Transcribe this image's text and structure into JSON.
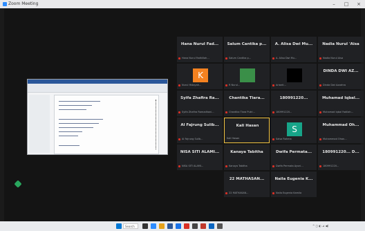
{
  "window": {
    "title": "Zoom Meeting",
    "accent": "#2d8cff"
  },
  "participants": [
    {
      "name": "Hana Nurul Fad...",
      "sub": "Hana Nurul Fadhillah...",
      "avatar": null
    },
    {
      "name": "Salum Cantika p...",
      "sub": "Salum Cantika p...",
      "avatar": null
    },
    {
      "name": "A. Alisa Dwi Mu...",
      "sub": "A. Alisa Dwi Mu...",
      "avatar": null
    },
    {
      "name": "Nadia Nurul 'Aisa",
      "sub": "Nadia Nurul Aisa",
      "avatar": null
    },
    {
      "name": "",
      "sub": "Nurul Hidayah...",
      "avatar": "K",
      "avatar_color": "#f58220"
    },
    {
      "name": "",
      "sub": "R Nurul...",
      "avatar": "",
      "avatar_color": "#3a8f48"
    },
    {
      "name": "",
      "sub": "Arianti...",
      "avatar": "",
      "avatar_color": "#000000"
    },
    {
      "name": "DINDA DWI AZ...",
      "sub": "Dinda Dwi Azzahra",
      "avatar": null
    },
    {
      "name": "Syifa Zhafira Ra...",
      "sub": "Syifa Zhafira Ramadhani...",
      "avatar": null
    },
    {
      "name": "Chantika Tiara...",
      "sub": "Chantika Tiara Putri...",
      "avatar": null
    },
    {
      "name": "180991220...",
      "sub": "180991220...",
      "avatar": null
    },
    {
      "name": "Muhamad Iqbal...",
      "sub": "Muhamad Iqbal Fadilah...",
      "avatar": null
    },
    {
      "name": "Al Fajrung Sulib...",
      "sub": "Al Fajrung Sulib...",
      "avatar": null
    },
    {
      "name": "Kali Hasan",
      "sub": "Kali Hasan",
      "avatar": null,
      "active": true
    },
    {
      "name": "",
      "sub": "Salsa Rahma",
      "avatar": "S",
      "avatar_color": "#17a589"
    },
    {
      "name": "Muhammad Oh...",
      "sub": "Muhammad Ohan...",
      "avatar": null
    },
    {
      "name": "NISA SITI ALAMI...",
      "sub": "NISA SITI ALAMI...",
      "avatar": null
    },
    {
      "name": "Kanaya Tabitha",
      "sub": "Kanaya Tabitha",
      "avatar": null
    },
    {
      "name": "Dwifa Permata...",
      "sub": "Dwifa Permata Ayuni...",
      "avatar": null
    },
    {
      "name": "180991220... D...",
      "sub": "180991220...",
      "avatar": null
    },
    {
      "name": "22 MATHASAN...",
      "sub": "22 MATHASAN...",
      "avatar": null
    },
    {
      "name": "Naila Eugenia K...",
      "sub": "Naila Eugenia Kamila",
      "avatar": null
    }
  ],
  "taskbar": {
    "search": "Search"
  }
}
